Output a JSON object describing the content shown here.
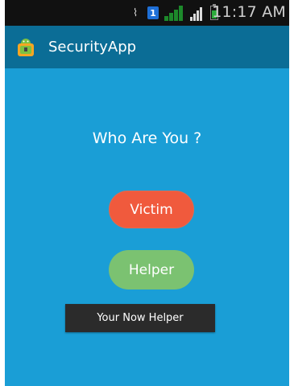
{
  "status_bar": {
    "time": "11:17 AM",
    "sim_label": "1",
    "icons": [
      "notification-icon",
      "sim-icon",
      "signal-icon",
      "signal-icon",
      "battery-icon"
    ]
  },
  "app_bar": {
    "title": "SecurityApp",
    "icon": "android-app-icon"
  },
  "main": {
    "heading": "Who Are You ?",
    "victim_label": "Victim",
    "helper_label": "Helper",
    "toast": "Your Now Helper"
  },
  "colors": {
    "background": "#1a9ed6",
    "app_bar": "#0b6d96",
    "victim": "#f05a3d",
    "helper": "#7bc271",
    "toast": "#2b2b2b"
  }
}
